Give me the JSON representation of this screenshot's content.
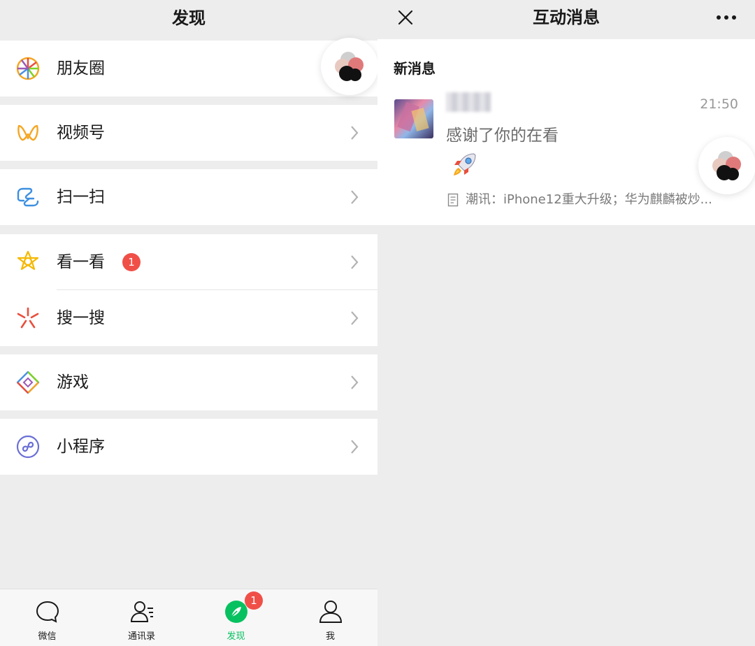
{
  "left": {
    "title": "发现",
    "menu": [
      {
        "label": "朋友圈",
        "icon": "moments-icon"
      },
      {
        "label": "视频号",
        "icon": "channels-icon"
      },
      {
        "label": "扫一扫",
        "icon": "scan-icon"
      },
      {
        "label": "看一看",
        "icon": "top-stories-icon",
        "badge": "1"
      },
      {
        "label": "搜一搜",
        "icon": "search-icon"
      },
      {
        "label": "游戏",
        "icon": "games-icon"
      },
      {
        "label": "小程序",
        "icon": "mini-programs-icon"
      }
    ],
    "tabs": [
      {
        "label": "微信",
        "icon": "chat-bubble-icon"
      },
      {
        "label": "通讯录",
        "icon": "contacts-icon"
      },
      {
        "label": "发现",
        "icon": "discover-compass-icon",
        "active": true
      },
      {
        "label": "我",
        "icon": "me-person-icon"
      }
    ],
    "tab_badge": "1"
  },
  "right": {
    "title": "互动消息",
    "section_title": "新消息",
    "message": {
      "time": "21:50",
      "text": "感谢了你的在看",
      "emoji": "rocket-icon",
      "reference": "潮讯：iPhone12重大升级；华为麒麟被炒..."
    }
  },
  "colors": {
    "accent_green": "#07c160",
    "badge_red": "#f04f48",
    "background": "#ededed"
  }
}
